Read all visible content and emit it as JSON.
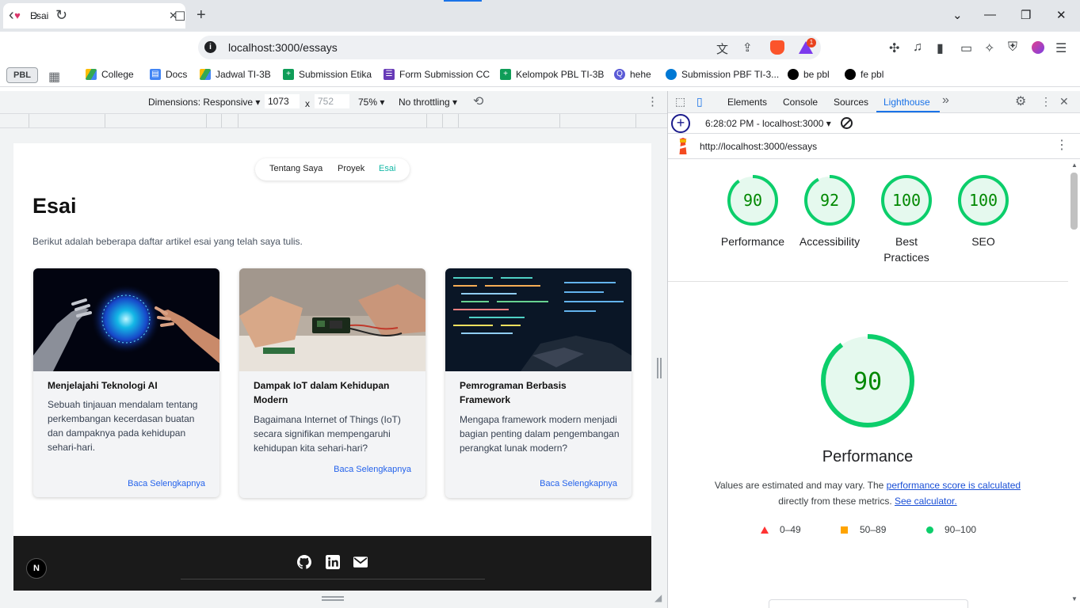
{
  "browser": {
    "tab_title": "Esai",
    "address": "localhost:3000/essays",
    "new_tab": "+",
    "tab_close": "✕",
    "win_min": "—",
    "win_max": "❐",
    "win_close": "✕"
  },
  "bookmarks": {
    "chip": "PBL",
    "items": [
      {
        "label": "College",
        "color": "#34a853"
      },
      {
        "label": "Docs",
        "color": "#4285f4"
      },
      {
        "label": "Jadwal TI-3B",
        "color": "#34a853"
      },
      {
        "label": "Submission Etika",
        "color": "#0f9d58"
      },
      {
        "label": "Form Submission CC",
        "color": "#673ab7"
      },
      {
        "label": "Kelompok PBL TI-3B",
        "color": "#0f9d58"
      },
      {
        "label": "hehe",
        "color": "#5b5bd6"
      },
      {
        "label": "Submission PBF TI-3...",
        "color": "#0078d4"
      },
      {
        "label": "be pbl",
        "color": "#000000"
      },
      {
        "label": "fe pbl",
        "color": "#000000"
      }
    ]
  },
  "device_toolbar": {
    "dimensions": "Dimensions: Responsive ▾",
    "width": "1073",
    "times": "x",
    "height": "752",
    "zoom": "75% ▾",
    "throttling": "No throttling ▾"
  },
  "site": {
    "nav": [
      "Tentang Saya",
      "Proyek",
      "Esai"
    ],
    "title": "Esai",
    "description": "Berikut adalah beberapa daftar artikel esai yang telah saya tulis.",
    "cards": [
      {
        "title": "Menjelajahi Teknologi AI",
        "desc": "Sebuah tinjauan mendalam tentang perkembangan kecerdasan buatan dan dampaknya pada kehidupan sehari-hari.",
        "link": "Baca Selengkapnya"
      },
      {
        "title": "Dampak IoT dalam Kehidupan Modern",
        "desc": "Bagaimana Internet of Things (IoT) secara signifikan mempengaruhi kehidupan kita sehari-hari?",
        "link": "Baca Selengkapnya"
      },
      {
        "title": "Pemrograman Berbasis Framework",
        "desc": "Mengapa framework modern menjadi bagian penting dalam pengembangan perangkat lunak modern?",
        "link": "Baca Selengkapnya"
      }
    ],
    "next_badge": "N"
  },
  "devtools": {
    "tabs": [
      "Elements",
      "Console",
      "Sources",
      "Lighthouse"
    ],
    "more": "»",
    "report": "6:28:02 PM - localhost:3000 ▾",
    "url": "http://localhost:3000/essays",
    "scores": [
      {
        "value": 90,
        "label": "Performance"
      },
      {
        "value": 92,
        "label": "Accessibility"
      },
      {
        "value": 100,
        "label": "Best Practices"
      },
      {
        "value": 100,
        "label": "SEO"
      }
    ],
    "main_score": {
      "value": 90,
      "label": "Performance"
    },
    "note_1": "Values are estimated and may vary. The ",
    "note_link_1": "performance score is calculated",
    "note_2": "directly from these metrics. ",
    "note_link_2": "See calculator.",
    "legend": [
      "0–49",
      "50–89",
      "90–100"
    ],
    "colors": {
      "pass": "#0cce6b",
      "pass_fill": "#e5f9ee",
      "pass_text": "#008800",
      "average": "#ffa400",
      "fail": "#ff3333"
    }
  }
}
